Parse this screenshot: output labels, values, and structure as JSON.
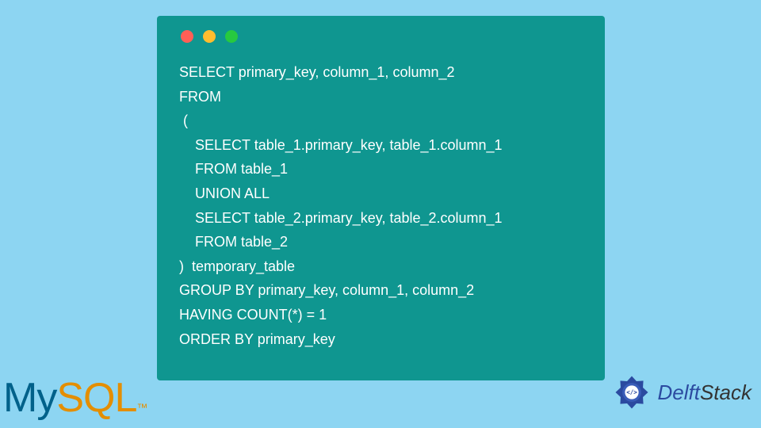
{
  "code": {
    "line1": "SELECT primary_key, column_1, column_2",
    "line2": "FROM",
    "line3": " (",
    "line4": "    SELECT table_1.primary_key, table_1.column_1",
    "line5": "    FROM table_1",
    "line6": "    UNION ALL",
    "line7": "    SELECT table_2.primary_key, table_2.column_1",
    "line8": "    FROM table_2",
    "line9": ")  temporary_table",
    "line10": "GROUP BY primary_key, column_1, column_2",
    "line11": "HAVING COUNT(*) = 1",
    "line12": "ORDER BY primary_key"
  },
  "logos": {
    "mysql_my": "My",
    "mysql_sql": "SQL",
    "mysql_tm": "™",
    "delft": "Delft",
    "stack": "Stack"
  }
}
